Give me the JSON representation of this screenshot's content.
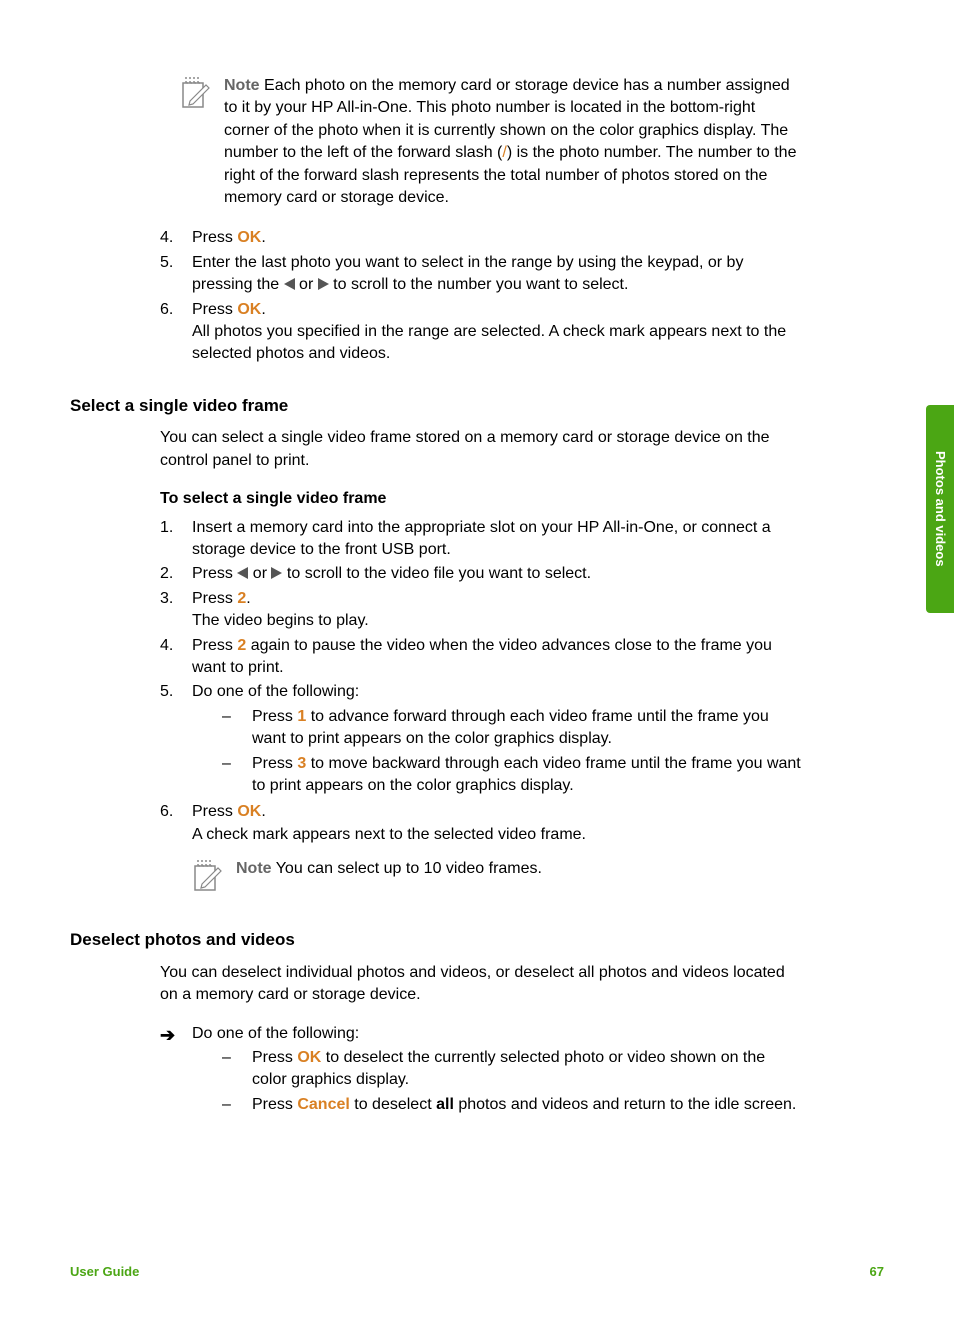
{
  "sideTab": "Photos and videos",
  "note1": {
    "label": "Note",
    "text_a": "Each photo on the memory card or storage device has a number assigned to it by your HP All-in-One. This photo number is located in the bottom-right corner of the photo when it is currently shown on the color graphics display. The number to the left of the forward slash (",
    "slash": "/",
    "text_b": ") is the photo number. The number to the right of the forward slash represents the total number of photos stored on the memory card or storage device."
  },
  "ol1": {
    "i4": {
      "n": "4.",
      "a": "Press ",
      "ok": "OK",
      "b": "."
    },
    "i5": {
      "n": "5.",
      "a": "Enter the last photo you want to select in the range by using the keypad, or by pressing the ",
      "mid": " or ",
      "b": " to scroll to the number you want to select."
    },
    "i6": {
      "n": "6.",
      "a": "Press ",
      "ok": "OK",
      "b": ".",
      "c": "All photos you specified in the range are selected. A check mark appears next to the selected photos and videos."
    }
  },
  "h_video": "Select a single video frame",
  "video_intro": "You can select a single video frame stored on a memory card or storage device on the control panel to print.",
  "video_sub": "To select a single video frame",
  "ol2": {
    "i1": {
      "n": "1.",
      "t": "Insert a memory card into the appropriate slot on your HP All-in-One, or connect a storage device to the front USB port."
    },
    "i2": {
      "n": "2.",
      "a": "Press ",
      "mid": " or ",
      "b": " to scroll to the video file you want to select."
    },
    "i3": {
      "n": "3.",
      "a": "Press ",
      "k": "2",
      "b": ".",
      "c": "The video begins to play."
    },
    "i4": {
      "n": "4.",
      "a": "Press ",
      "k": "2",
      "b": " again to pause the video when the video advances close to the frame you want to print."
    },
    "i5": {
      "n": "5.",
      "t": "Do one of the following:",
      "s1": {
        "a": "Press ",
        "k": "1",
        "b": " to advance forward through each video frame until the frame you want to print appears on the color graphics display."
      },
      "s2": {
        "a": "Press ",
        "k": "3",
        "b": " to move backward through each video frame until the frame you want to print appears on the color graphics display."
      }
    },
    "i6": {
      "n": "6.",
      "a": "Press ",
      "ok": "OK",
      "b": ".",
      "c": "A check mark appears next to the selected video frame."
    }
  },
  "note2": {
    "label": "Note",
    "text": "You can select up to 10 video frames."
  },
  "h_deselect": "Deselect photos and videos",
  "deselect_intro": "You can deselect individual photos and videos, or deselect all photos and videos located on a memory card or storage device.",
  "deselect": {
    "lead": "Do one of the following:",
    "s1": {
      "a": "Press ",
      "ok": "OK",
      "b": " to deselect the currently selected photo or video shown on the color graphics display."
    },
    "s2": {
      "a": "Press ",
      "cancel": "Cancel",
      "b": " to deselect ",
      "all": "all",
      "c": " photos and videos and return to the idle screen."
    }
  },
  "footer": {
    "left": "User Guide",
    "right": "67"
  }
}
